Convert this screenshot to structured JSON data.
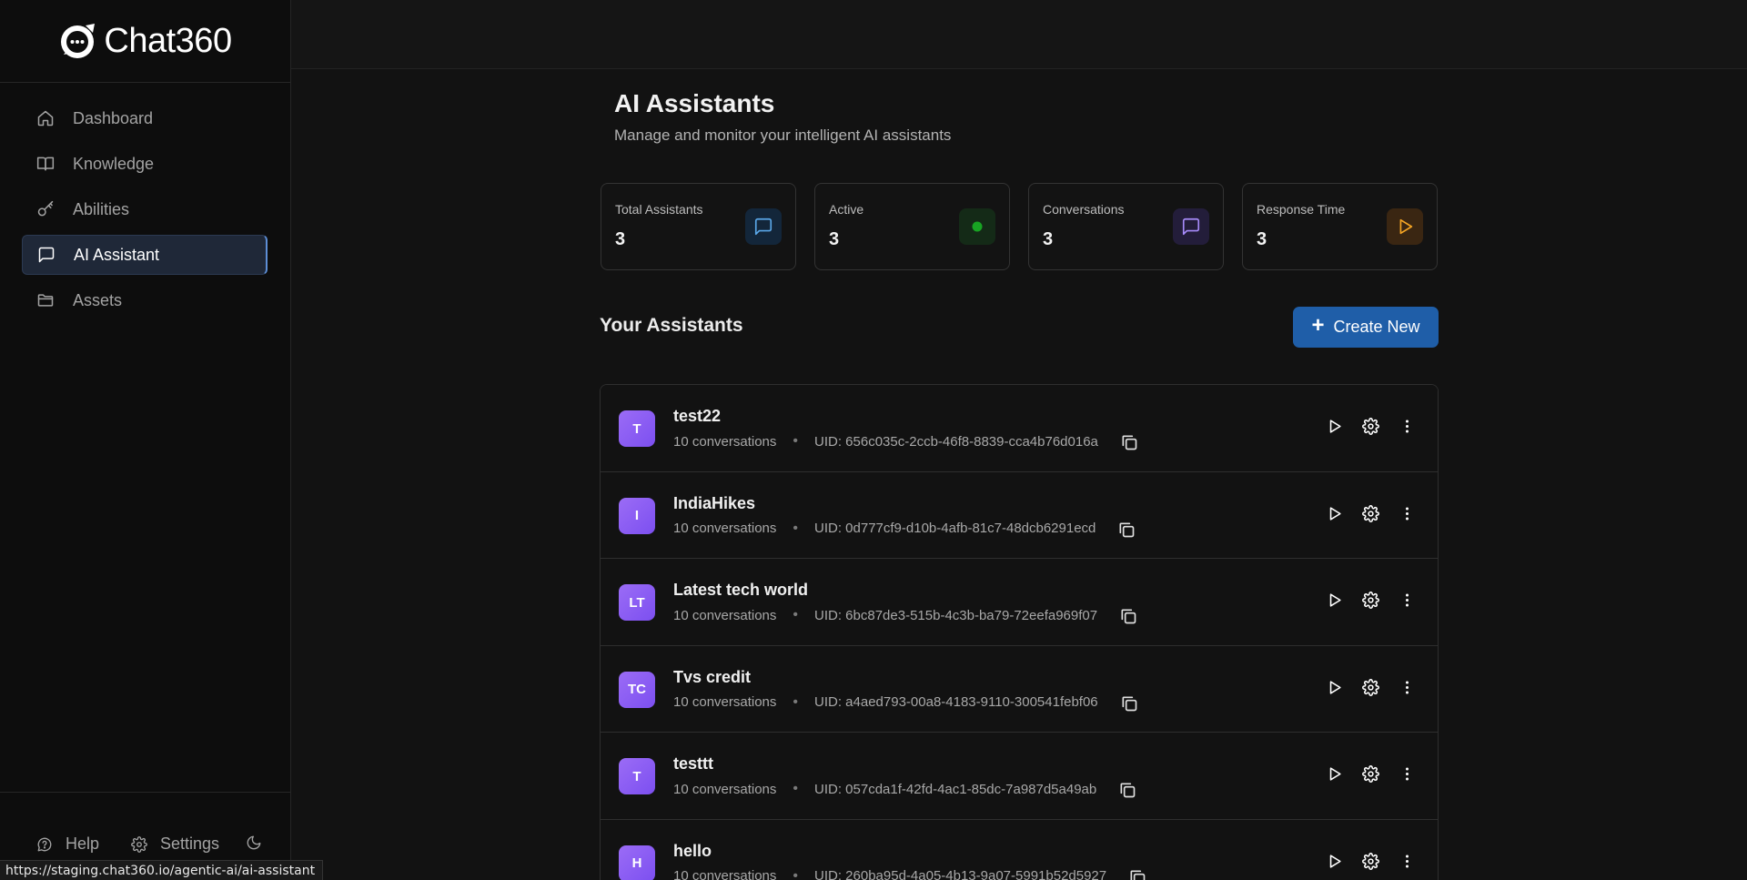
{
  "app": {
    "name": "Chat360"
  },
  "sidebar": {
    "items": [
      {
        "label": "Dashboard",
        "icon": "home-icon"
      },
      {
        "label": "Knowledge",
        "icon": "book-icon"
      },
      {
        "label": "Abilities",
        "icon": "key-icon"
      },
      {
        "label": "AI Assistant",
        "icon": "chat-icon",
        "active": true
      },
      {
        "label": "Assets",
        "icon": "folder-icon"
      }
    ],
    "bottom": {
      "help": "Help",
      "settings": "Settings"
    }
  },
  "page": {
    "title": "AI Assistants",
    "subtitle": "Manage and monitor your intelligent AI assistants"
  },
  "stats": [
    {
      "label": "Total Assistants",
      "value": "3",
      "icon": "chat-icon",
      "color": "#5aa7e8"
    },
    {
      "label": "Active",
      "value": "3",
      "icon": "status-dot-icon",
      "color": "#18a323"
    },
    {
      "label": "Conversations",
      "value": "3",
      "icon": "chat-icon",
      "color": "#a78bfa"
    },
    {
      "label": "Response Time",
      "value": "3",
      "icon": "play-icon",
      "color": "#f5a524"
    }
  ],
  "assistants_section": {
    "title": "Your Assistants",
    "create_label": "Create New"
  },
  "assistants": [
    {
      "initials": "T",
      "name": "test22",
      "conversations": "10 conversations",
      "uid": "UID: 656c035c-2ccb-46f8-8839-cca4b76d016a"
    },
    {
      "initials": "I",
      "name": "IndiaHikes",
      "conversations": "10 conversations",
      "uid": "UID: 0d777cf9-d10b-4afb-81c7-48dcb6291ecd"
    },
    {
      "initials": "LT",
      "name": "Latest tech world",
      "conversations": "10 conversations",
      "uid": "UID: 6bc87de3-515b-4c3b-ba79-72eefa969f07"
    },
    {
      "initials": "TC",
      "name": "Tvs credit",
      "conversations": "10 conversations",
      "uid": "UID: a4aed793-00a8-4183-9110-300541febf06"
    },
    {
      "initials": "T",
      "name": "testtt",
      "conversations": "10 conversations",
      "uid": "UID: 057cda1f-42fd-4ac1-85dc-7a987d5a49ab"
    },
    {
      "initials": "H",
      "name": "hello",
      "conversations": "10 conversations",
      "uid": "UID: 260ba95d-4a05-4b13-9a07-5991b52d5927"
    }
  ],
  "status_bar": {
    "url": "https://staging.chat360.io/agentic-ai/ai-assistant"
  },
  "colors": {
    "accent": "#1f5ea8",
    "avatar": "#8b5cf6",
    "background": "#121212",
    "sidebar": "#0d0d0d"
  }
}
